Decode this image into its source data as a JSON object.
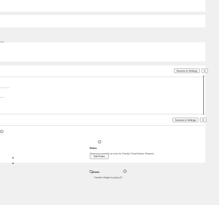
{
  "top": {
    "label_fragment": "ibes"
  },
  "section1": {
    "sources_button": "Sources & Settings",
    "extra_button": "S"
  },
  "section2": {
    "sources_button": "Sources & Settings",
    "extra_button": "S",
    "roles": {
      "heading": "Roles",
      "description": "There are currently no rules for Directly Portal feature Request",
      "edit_button": "Edit Roles"
    },
    "options": {
      "heading": "Options",
      "checkbox_label": "Transfer Weight to policy ID",
      "checked": false
    }
  },
  "colors": {
    "accent": "#7a72d4",
    "background": "#f0f0f1",
    "panel": "#ffffff"
  },
  "icons": [
    "help-icon",
    "bullet-icon",
    "checkbox-icon"
  ]
}
